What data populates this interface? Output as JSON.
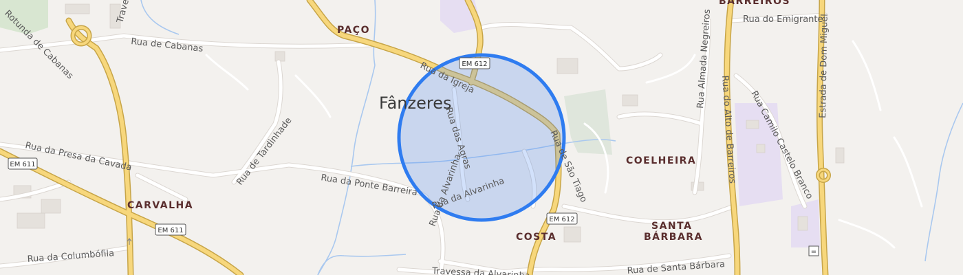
{
  "map": {
    "colors": {
      "background": "#f3f1ee",
      "minor_road": "#ffffff",
      "major_road": "#f7d77c",
      "major_road_casing": "#c7a548",
      "water": "#a9c8ef",
      "park": "#dfe6dc",
      "special_area": "#e6def2",
      "radius_fill": "#4a86f0",
      "radius_stroke": "#2f7cf0",
      "neighbourhood_label": "#5a2e2e"
    },
    "place_label": "Fânzeres",
    "neighbourhoods": {
      "barreiros": "BARREIROS",
      "paco": "PAÇO",
      "coelheira": "COELHEIRA",
      "carvalha": "CARVALHA",
      "santa_line1": "SANTA",
      "santa_line2": "BÁRBARA",
      "costa": "COSTA"
    },
    "streets": {
      "emigrante": "Rua do Emigrante",
      "cabanas": "Rua de Cabanas",
      "igreja": "Rua da Igreja",
      "agras": "Rua das Agras",
      "santiago": "Rua de São Tiago",
      "tardinhade": "Rua de Tardinhade",
      "presa": "Rua da Presa da Cavada",
      "ponte": "Rua da Ponte Barreira",
      "alvarinha": "Rua da Alvarinha",
      "alvarinha_side": "Rua da Alvarinha",
      "trav_alvarinha": "Travessa da Alvarinha",
      "columbofila": "Rua da Columbófila",
      "santa_barbara": "Rua de Santa Bárbara",
      "almada": "Rua Almada Negreiros",
      "alto_barreiros": "Rua do Alto de Barreiros",
      "camilo": "Rua Camilo Castelo Branco",
      "dom_miguel": "Estrada de Dom Miguel",
      "rotunda": "Rotunda de Cabanas",
      "travessa_top": "Travessa"
    },
    "road_shields": {
      "em612_top": "EM 612",
      "em612_bottom": "EM 612",
      "em611_left": "EM 611",
      "em611_mid": "EM 611"
    },
    "search_radius": {
      "center_street": "Rua da Igreja",
      "shape": "circle"
    }
  }
}
